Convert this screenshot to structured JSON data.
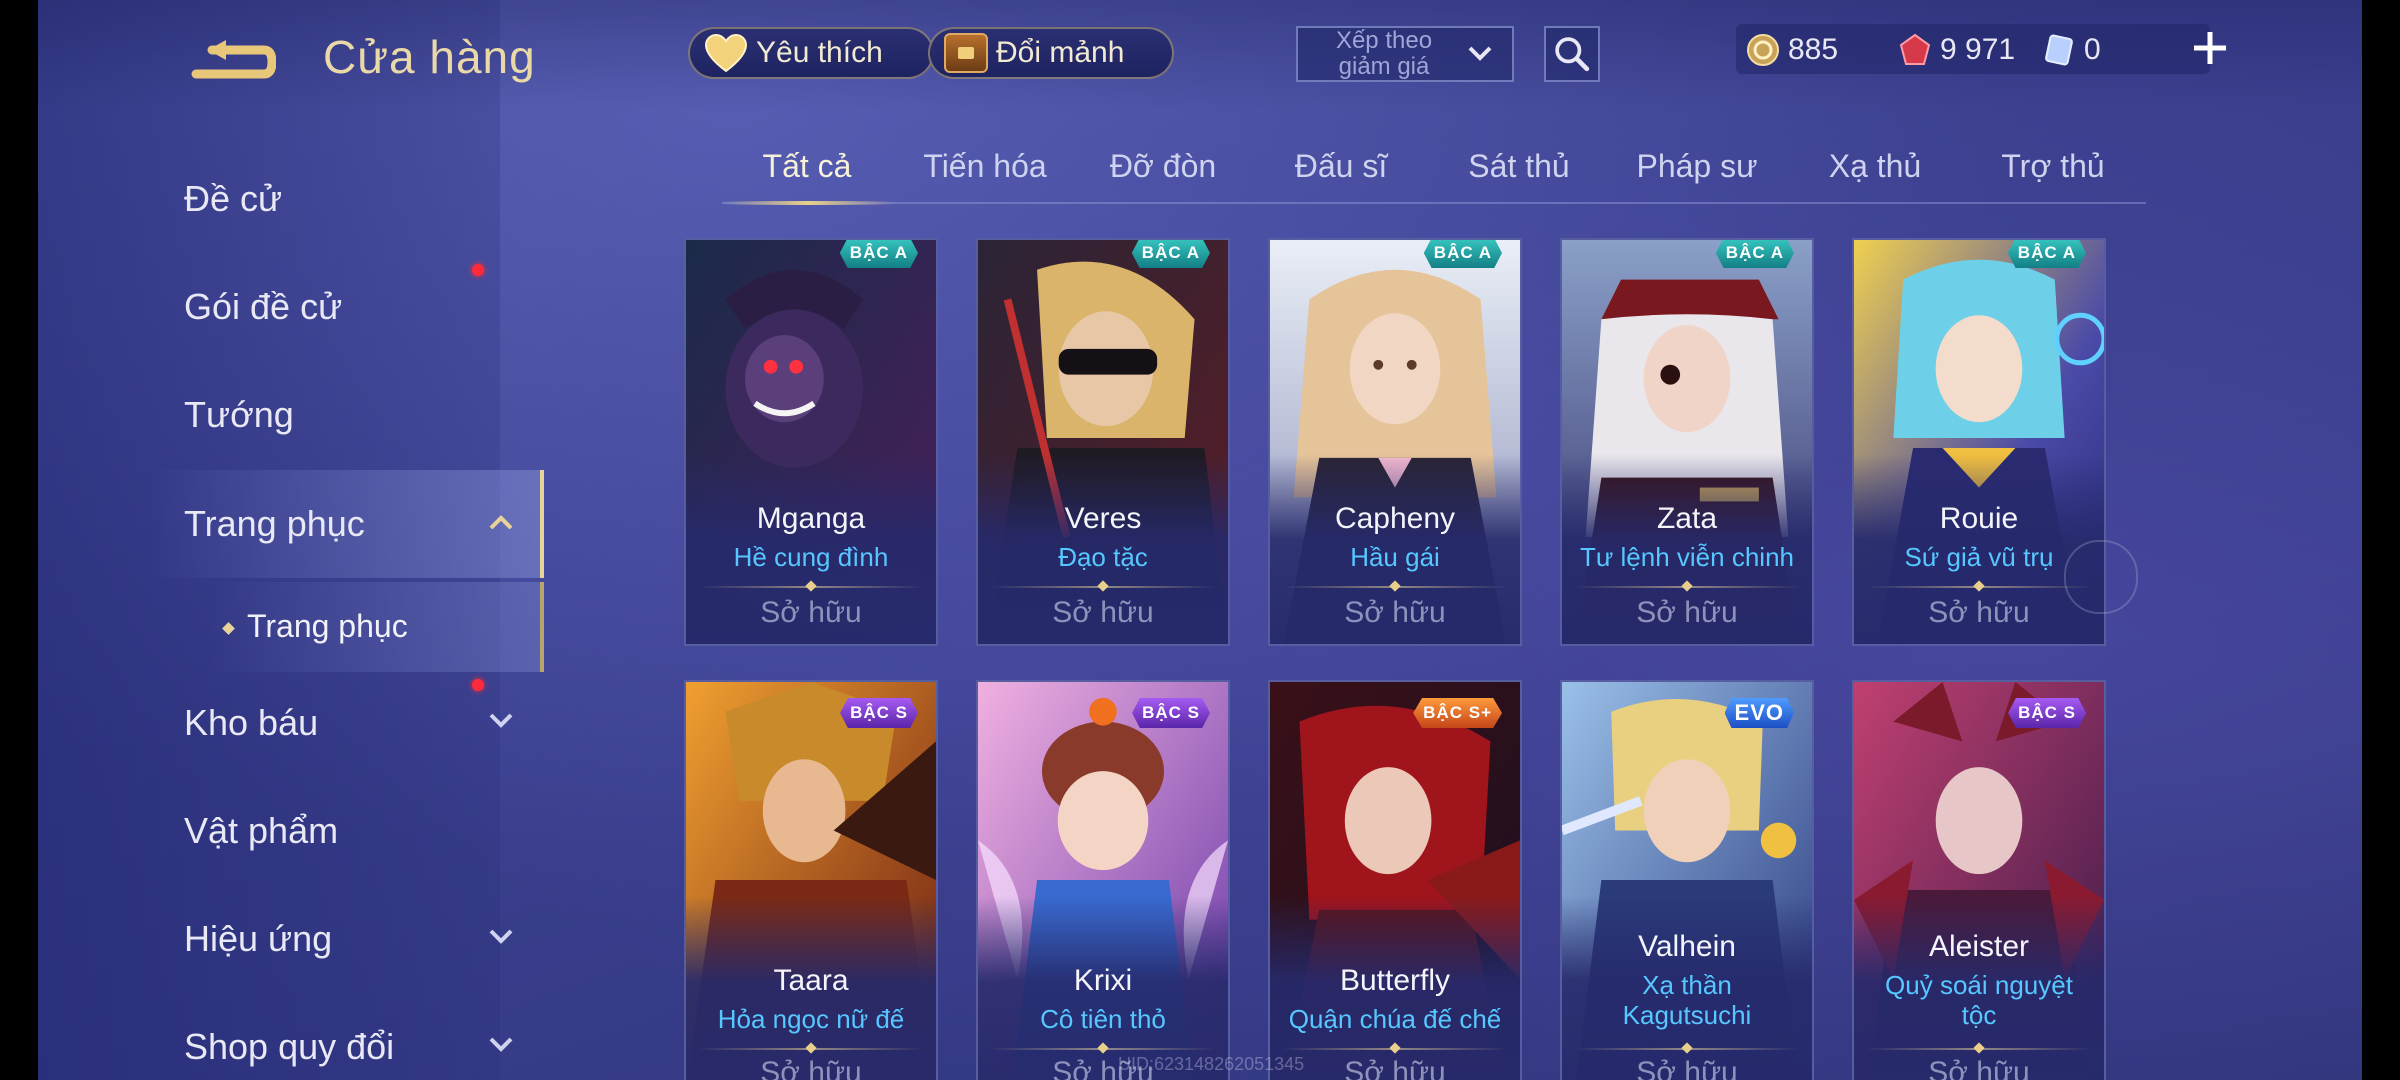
{
  "header": {
    "title": "Cửa hàng",
    "favorites_label": "Yêu thích",
    "shard_exchange_label": "Đổi mảnh",
    "sort_label": "Xếp theo giảm giá"
  },
  "currencies": {
    "gold": "885",
    "voucher": "9 971",
    "ticket": "0"
  },
  "sidebar": {
    "items": [
      {
        "label": "Đề cử"
      },
      {
        "label": "Gói đề cử"
      },
      {
        "label": "Tướng"
      },
      {
        "label": "Trang phục"
      },
      {
        "label": "Kho báu"
      },
      {
        "label": "Vật phẩm"
      },
      {
        "label": "Hiệu ứng"
      },
      {
        "label": "Shop quy đổi"
      }
    ],
    "sub_item": "Trang phục"
  },
  "tabs": [
    "Tất cả",
    "Tiến hóa",
    "Đỡ đòn",
    "Đấu sĩ",
    "Sát thủ",
    "Pháp sư",
    "Xạ thủ",
    "Trợ thủ"
  ],
  "cards": [
    {
      "hero": "Mganga",
      "skin": "Hề cung đình",
      "status": "Sở hữu",
      "badge": "BẬC A"
    },
    {
      "hero": "Veres",
      "skin": "Đạo tặc",
      "status": "Sở hữu",
      "badge": "BẬC A"
    },
    {
      "hero": "Capheny",
      "skin": "Hầu gái",
      "status": "Sở hữu",
      "badge": "BẬC A"
    },
    {
      "hero": "Zata",
      "skin": "Tư lệnh viễn chinh",
      "status": "Sở hữu",
      "badge": "BẬC A"
    },
    {
      "hero": "Rouie",
      "skin": "Sứ giả vũ trụ",
      "status": "Sở hữu",
      "badge": "BẬC A"
    },
    {
      "hero": "Taara",
      "skin": "Hỏa ngọc nữ đế",
      "status": "Sở hữu",
      "badge": "BẬC S"
    },
    {
      "hero": "Krixi",
      "skin": "Cô tiên thỏ",
      "status": "Sở hữu",
      "badge": "BẬC S"
    },
    {
      "hero": "Butterfly",
      "skin": "Quận chúa đế chế",
      "status": "Sở hữu",
      "badge": "BẬC S+"
    },
    {
      "hero": "Valhein",
      "skin": "Xạ thần Kagutsuchi",
      "status": "Sở hữu",
      "badge": "EVO"
    },
    {
      "hero": "Aleister",
      "skin": "Quỷ soái nguyệt tộc",
      "status": "Sở hữu",
      "badge": "BẬC S"
    }
  ],
  "watermark": "UID:623148262051345",
  "icons": {
    "back": "back-arrow-icon",
    "favorites": "heart-icon",
    "shard": "chest-icon",
    "search": "search-icon",
    "gold": "gold-coin-icon",
    "voucher": "red-gem-icon",
    "ticket": "ticket-icon",
    "add": "plus-icon"
  },
  "colors": {
    "accent_gold": "#e8d08c",
    "skin_name": "#56c7ff",
    "notification_dot": "#ff2b3a",
    "badge_a": "#26a8aa",
    "badge_s": "#8845d6",
    "badge_splus": "#e0702c",
    "badge_evo": "#2f6ee2"
  }
}
